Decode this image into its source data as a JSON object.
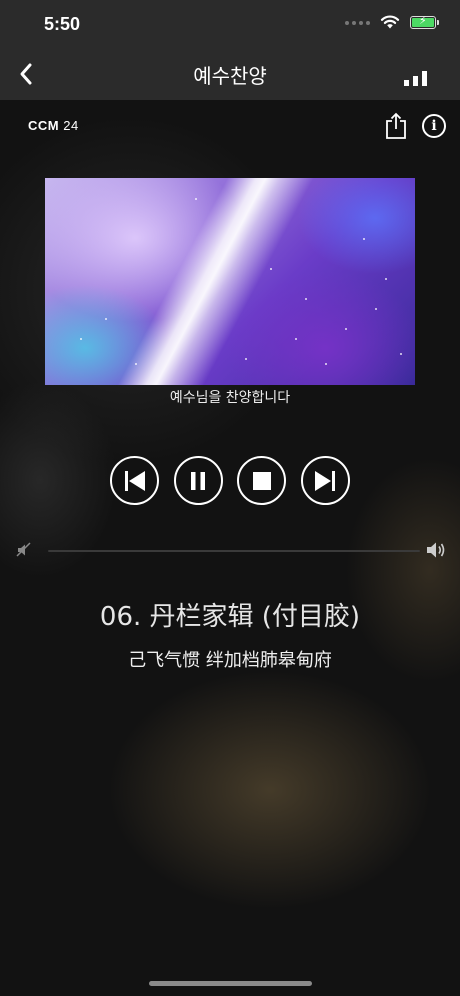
{
  "status": {
    "time": "5:50",
    "icons": [
      "cell-dots-icon",
      "wifi-icon",
      "battery-charging-icon"
    ]
  },
  "nav": {
    "title": "예수찬양",
    "back_icon": "chevron-left-icon",
    "menu_icon": "signal-bars-icon"
  },
  "player": {
    "logo_main": "CCM",
    "logo_num": "24",
    "caption": "예수님을 찬양합니다",
    "controls": [
      "skip-previous-icon",
      "pause-icon",
      "stop-icon",
      "skip-next-icon"
    ],
    "song_title": "06. 丹栏家辑 (付目胶)",
    "song_subtitle": "己飞气惯 绊加档肺皋甸府"
  },
  "colors": {
    "bar_bg": "#2b2b2b",
    "main_bg": "#121212",
    "battery": "#4cd964"
  }
}
